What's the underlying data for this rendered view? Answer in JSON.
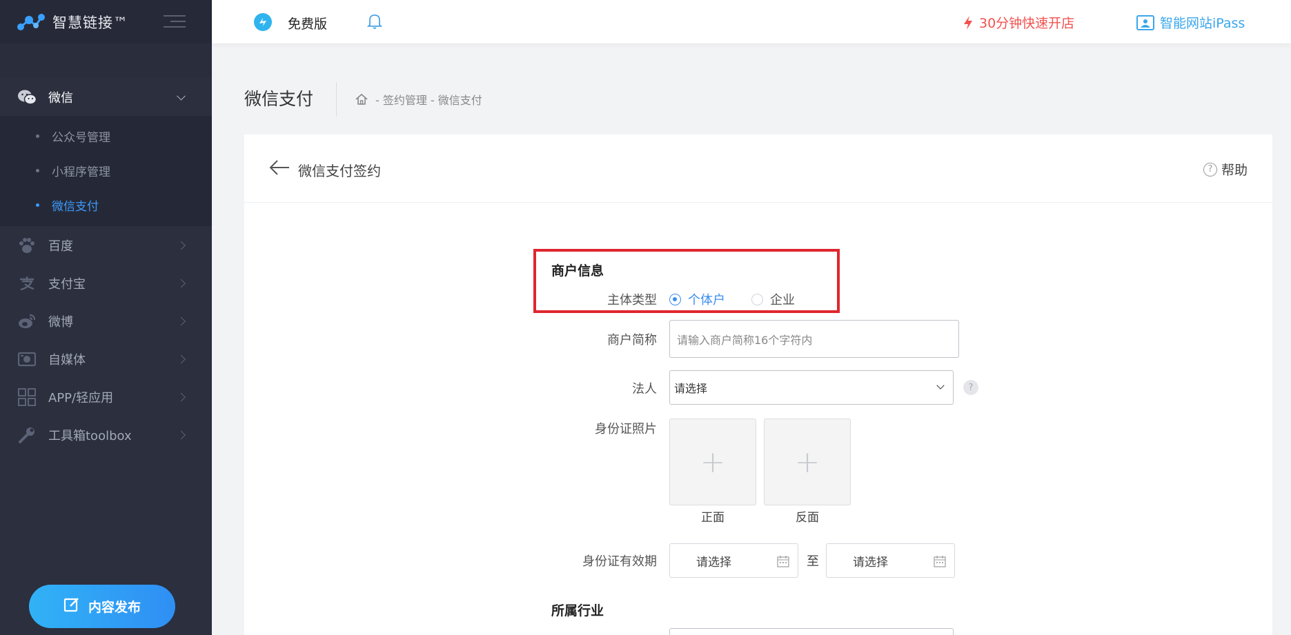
{
  "brand": {
    "name": "智慧链接™"
  },
  "sidebar": {
    "items": [
      {
        "label": "微信",
        "icon": "wechat-icon",
        "open": true
      },
      {
        "label": "百度",
        "icon": "paw-icon"
      },
      {
        "label": "支付宝",
        "icon": "alipay-icon"
      },
      {
        "label": "微博",
        "icon": "weibo-icon"
      },
      {
        "label": "自媒体",
        "icon": "media-icon"
      },
      {
        "label": "APP/轻应用",
        "icon": "app-grid-icon"
      },
      {
        "label": "工具箱toolbox",
        "icon": "wrench-icon"
      }
    ],
    "sub_items": [
      {
        "label": "公众号管理"
      },
      {
        "label": "小程序管理"
      },
      {
        "label": "微信支付",
        "active": true
      }
    ],
    "publish_label": "内容发布"
  },
  "topbar": {
    "free_label": "免费版",
    "quick_open": "30分钟快速开店",
    "ipass": "智能网站iPass"
  },
  "page": {
    "title": "微信支付",
    "breadcrumb": "- 签约管理 - 微信支付"
  },
  "card": {
    "title": "微信支付签约",
    "help": "帮助"
  },
  "form": {
    "merchant_section": "商户信息",
    "entity_type_label": "主体类型",
    "entity_options": [
      {
        "label": "个体户",
        "checked": true
      },
      {
        "label": "企业",
        "checked": false
      }
    ],
    "short_name_label": "商户简称",
    "short_name_placeholder": "请输入商户简称16个字符内",
    "legal_label": "法人",
    "legal_value": "请选择",
    "id_photo_label": "身份证照片",
    "front_label": "正面",
    "back_label": "反面",
    "id_valid_label": "身份证有效期",
    "date_start": "请选择",
    "date_to": "至",
    "date_end": "请选择",
    "industry_section": "所属行业"
  },
  "colors": {
    "accent": "#3d9bff",
    "sidebar_bg": "#2b2f3e",
    "highlight_box": "#e0262e",
    "quick_open": "#f2514f"
  }
}
